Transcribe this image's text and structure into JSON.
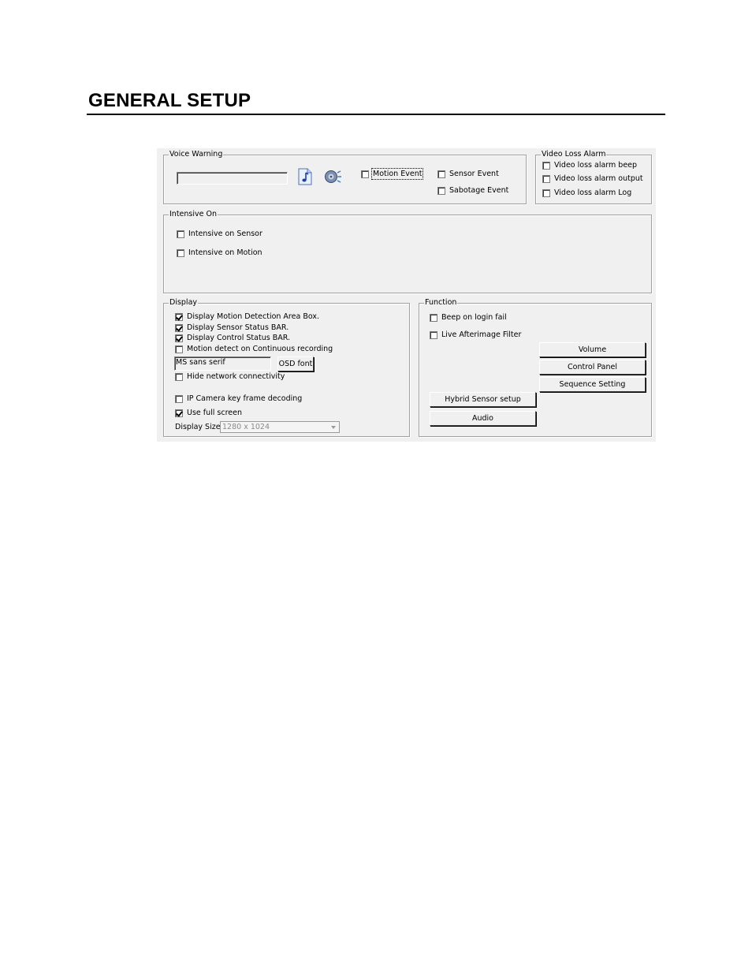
{
  "page": {
    "title": "GENERAL SETUP"
  },
  "voice_warning": {
    "title": "Voice Warning",
    "sound_file_value": "",
    "motion_event": "Motion Event",
    "sensor_event": "Sensor Event",
    "sabotage_event": "Sabotage Event"
  },
  "video_loss_alarm": {
    "title": "Video Loss Alarm",
    "beep": "Video loss alarm beep",
    "output": "Video loss alarm output",
    "log": "Video loss alarm Log"
  },
  "intensive_on": {
    "title": "Intensive On",
    "sensor": "Intensive on Sensor",
    "motion": "Intensive on Motion"
  },
  "display": {
    "title": "Display",
    "motion_area_box": "Display Motion Detection Area Box.",
    "sensor_status_bar": "Display Sensor Status BAR.",
    "control_status_bar": "Display Control Status BAR.",
    "motion_continuous": "Motion detect on Continuous recording",
    "font_value": "MS sans serif",
    "osd_font_button": "OSD font",
    "hide_network": "Hide network connectivity",
    "ip_camera_keyframe": "IP Camera key frame decoding",
    "use_full_screen": "Use full screen",
    "display_size_label": "Display Size :",
    "display_size_value": "1280 x 1024"
  },
  "function": {
    "title": "Function",
    "beep_login_fail": "Beep on login fail",
    "live_afterimage": "Live Afterimage Filter",
    "volume_button": "Volume",
    "control_panel_button": "Control Panel",
    "sequence_button": "Sequence Setting",
    "hybrid_sensor_button": "Hybrid Sensor setup",
    "audio_button": "Audio"
  }
}
